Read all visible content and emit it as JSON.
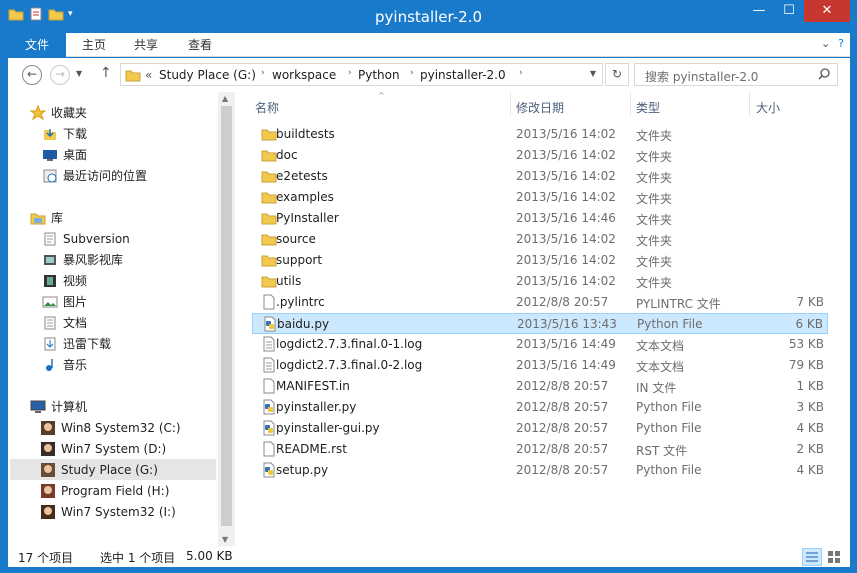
{
  "window": {
    "title": "pyinstaller-2.0"
  },
  "ribbon": {
    "tabs": [
      "文件",
      "主页",
      "共享",
      "查看"
    ]
  },
  "address": {
    "prefix": "«",
    "crumbs": [
      "Study Place (G:)",
      "workspace",
      "Python",
      "pyinstaller-2.0"
    ]
  },
  "search": {
    "placeholder": "搜索 pyinstaller-2.0"
  },
  "nav": {
    "favorites": {
      "label": "收藏夹",
      "items": [
        "下载",
        "桌面",
        "最近访问的位置"
      ]
    },
    "libraries": {
      "label": "库",
      "items": [
        "Subversion",
        "暴风影视库",
        "视频",
        "图片",
        "文档",
        "迅雷下载",
        "音乐"
      ]
    },
    "computer": {
      "label": "计算机",
      "items": [
        "Win8 System32 (C:)",
        "Win7 System (D:)",
        "Study Place (G:)",
        "Program Field (H:)",
        "Win7 System32 (I:)"
      ],
      "selected": "Study Place (G:)"
    }
  },
  "columns": {
    "name": "名称",
    "date": "修改日期",
    "type": "类型",
    "size": "大小"
  },
  "files": [
    {
      "name": "buildtests",
      "date": "2013/5/16 14:02",
      "type": "文件夹",
      "size": "",
      "icon": "folder"
    },
    {
      "name": "doc",
      "date": "2013/5/16 14:02",
      "type": "文件夹",
      "size": "",
      "icon": "folder"
    },
    {
      "name": "e2etests",
      "date": "2013/5/16 14:02",
      "type": "文件夹",
      "size": "",
      "icon": "folder"
    },
    {
      "name": "examples",
      "date": "2013/5/16 14:02",
      "type": "文件夹",
      "size": "",
      "icon": "folder"
    },
    {
      "name": "PyInstaller",
      "date": "2013/5/16 14:46",
      "type": "文件夹",
      "size": "",
      "icon": "folder"
    },
    {
      "name": "source",
      "date": "2013/5/16 14:02",
      "type": "文件夹",
      "size": "",
      "icon": "folder"
    },
    {
      "name": "support",
      "date": "2013/5/16 14:02",
      "type": "文件夹",
      "size": "",
      "icon": "folder"
    },
    {
      "name": "utils",
      "date": "2013/5/16 14:02",
      "type": "文件夹",
      "size": "",
      "icon": "folder"
    },
    {
      "name": ".pylintrc",
      "date": "2012/8/8 20:57",
      "type": "PYLINTRC 文件",
      "size": "7 KB",
      "icon": "file"
    },
    {
      "name": "baidu.py",
      "date": "2013/5/16 13:43",
      "type": "Python File",
      "size": "6 KB",
      "icon": "python",
      "selected": true
    },
    {
      "name": "logdict2.7.3.final.0-1.log",
      "date": "2013/5/16 14:49",
      "type": "文本文档",
      "size": "53 KB",
      "icon": "text"
    },
    {
      "name": "logdict2.7.3.final.0-2.log",
      "date": "2013/5/16 14:49",
      "type": "文本文档",
      "size": "79 KB",
      "icon": "text"
    },
    {
      "name": "MANIFEST.in",
      "date": "2012/8/8 20:57",
      "type": "IN 文件",
      "size": "1 KB",
      "icon": "file"
    },
    {
      "name": "pyinstaller.py",
      "date": "2012/8/8 20:57",
      "type": "Python File",
      "size": "3 KB",
      "icon": "python"
    },
    {
      "name": "pyinstaller-gui.py",
      "date": "2012/8/8 20:57",
      "type": "Python File",
      "size": "4 KB",
      "icon": "python"
    },
    {
      "name": "README.rst",
      "date": "2012/8/8 20:57",
      "type": "RST 文件",
      "size": "2 KB",
      "icon": "file"
    },
    {
      "name": "setup.py",
      "date": "2012/8/8 20:57",
      "type": "Python File",
      "size": "4 KB",
      "icon": "python"
    }
  ],
  "status": {
    "count": "17 个项目",
    "selected": "选中 1 个项目",
    "size": "5.00 KB"
  }
}
